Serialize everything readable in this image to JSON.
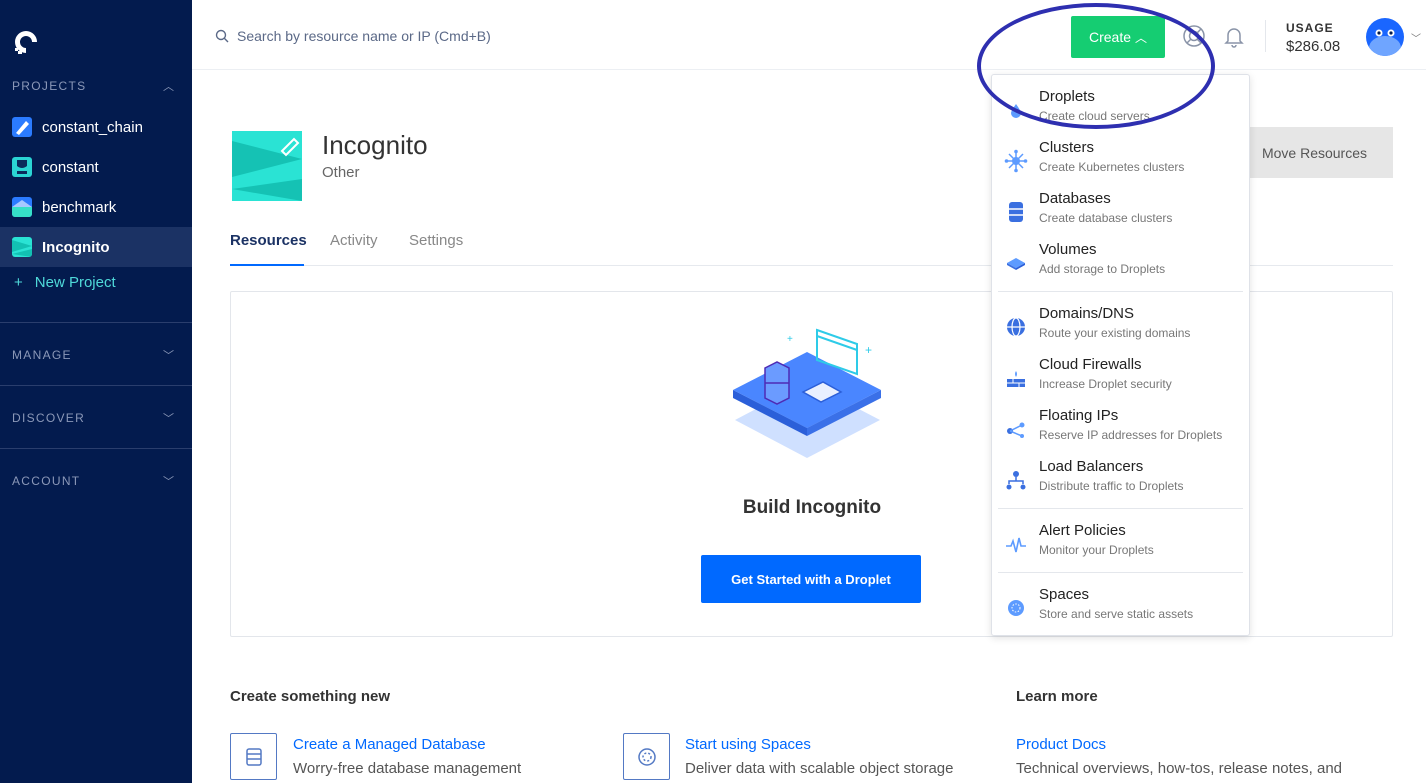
{
  "sidebar": {
    "projects_header": "PROJECTS",
    "projects": [
      {
        "label": "constant_chain"
      },
      {
        "label": "constant"
      },
      {
        "label": "benchmark"
      },
      {
        "label": "Incognito"
      }
    ],
    "new_project": "New Project",
    "sections": [
      "MANAGE",
      "DISCOVER",
      "ACCOUNT"
    ]
  },
  "header": {
    "search_placeholder": "Search by resource name or IP (Cmd+B)",
    "create_label": "Create",
    "usage_label": "USAGE",
    "usage_value": "$286.08"
  },
  "project": {
    "title": "Incognito",
    "subtitle": "Other",
    "move_button": "Move Resources",
    "tabs": [
      "Resources",
      "Activity",
      "Settings"
    ]
  },
  "empty_state": {
    "title": "Build Incognito",
    "button": "Get Started with a Droplet"
  },
  "create_new": {
    "title": "Create something new",
    "cards": [
      {
        "link": "Create a Managed Database",
        "desc": "Worry-free database management"
      },
      {
        "link": "Start using Spaces",
        "desc": "Deliver data with scalable object storage"
      }
    ]
  },
  "learn_more": {
    "title": "Learn more",
    "link": "Product Docs",
    "desc": "Technical overviews, how-tos, release notes, and"
  },
  "create_menu": [
    {
      "title": "Droplets",
      "desc": "Create cloud servers",
      "icon": "droplet-icon"
    },
    {
      "title": "Clusters",
      "desc": "Create Kubernetes clusters",
      "icon": "kubernetes-icon"
    },
    {
      "title": "Databases",
      "desc": "Create database clusters",
      "icon": "database-icon"
    },
    {
      "title": "Volumes",
      "desc": "Add storage to Droplets",
      "icon": "volume-icon"
    },
    {
      "title": "Domains/DNS",
      "desc": "Route your existing domains",
      "icon": "globe-icon"
    },
    {
      "title": "Cloud Firewalls",
      "desc": "Increase Droplet security",
      "icon": "firewall-icon"
    },
    {
      "title": "Floating IPs",
      "desc": "Reserve IP addresses for Droplets",
      "icon": "floating-ip-icon"
    },
    {
      "title": "Load Balancers",
      "desc": "Distribute traffic to Droplets",
      "icon": "load-balancer-icon"
    },
    {
      "title": "Alert Policies",
      "desc": "Monitor your Droplets",
      "icon": "alert-icon"
    },
    {
      "title": "Spaces",
      "desc": "Store and serve static assets",
      "icon": "spaces-icon"
    }
  ],
  "colors": {
    "sidebar_bg": "#031b4e",
    "create_green": "#15cd72",
    "primary_blue": "#0069ff",
    "annotation_ring": "#2e2fb0"
  }
}
